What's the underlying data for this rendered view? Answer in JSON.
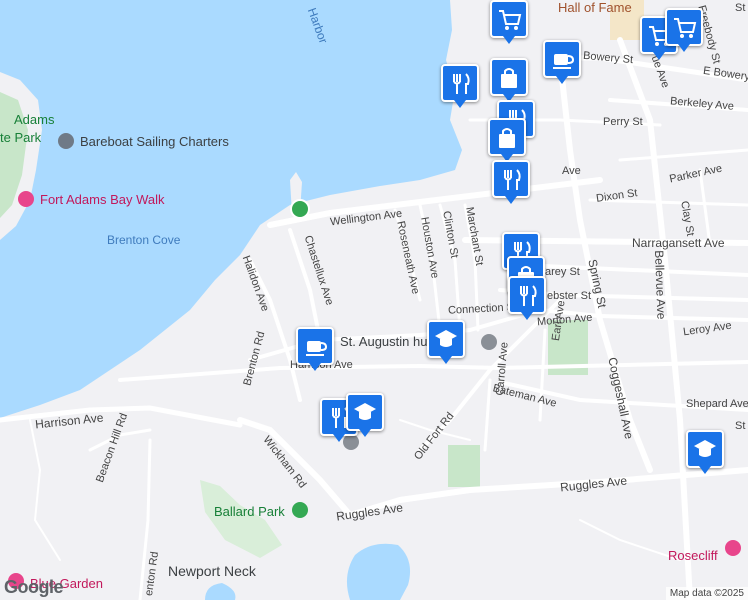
{
  "map": {
    "attribution": "Map data ©2025",
    "logo": "Google"
  },
  "water_labels": {
    "harbor": "Harbor",
    "cove": "Brenton Cove"
  },
  "poi_labels": {
    "hall_of_fame": "Hall of Fame",
    "adams_line1": "Adams",
    "adams_line2": "te Park",
    "sailing": "Bareboat Sailing Charters",
    "bay_walk": "Fort Adams Bay Walk",
    "church": "St. Augustin   hurch",
    "ballard": "Ballard Park",
    "newport_neck": "Newport Neck",
    "rosecliff": "Rosecliff",
    "garden": "Blue Garden"
  },
  "streets": {
    "wellington": "Wellington Ave",
    "narragansett": "Narragansett Ave",
    "bowery": "Bowery St",
    "e_bowery": "E Bowery",
    "berkeley": "Berkeley Ave",
    "perry": "Perry St",
    "parker": "Parker Ave",
    "dixon": "Dixon St",
    "clay": "Clay St",
    "halidon": "Halidon Ave",
    "chastellux": "Chastellux Ave",
    "roseneath": "Roseneath Ave",
    "houston": "Houston Ave",
    "clinton": "Clinton St",
    "marchant": "Marchant St",
    "carey": "arey St",
    "webster": "ebster St",
    "connection": "Connection St",
    "morton": "Morton Ave",
    "leroy": "Leroy Ave",
    "spring": "Spring St",
    "coggeshall": "Coggeshall Ave",
    "bellevue": "Bellevue Ave",
    "bellevue_top": "ue Ave",
    "freebody": "Freebody St",
    "harrison_s": "Harrison Ave",
    "harrison_n": "Harrison Ave",
    "bateman": "Bateman Ave",
    "earl": "Earl Ave",
    "carroll": "Carroll Ave",
    "old_fort": "Old Fort Rd",
    "shepard": "Shepard Ave",
    "ruggles_w": "Ruggles Ave",
    "ruggles_e": "Ruggles Ave",
    "brenton": "Brenton Rd",
    "wickham": "Wickham Rd",
    "beacon_hill": "Beacon Hill Rd",
    "brenton_s": "enton Rd",
    "avenue": "Ave",
    "st_a": "St",
    "st_b": "St"
  },
  "markers": [
    {
      "icon": "shopping-cart-icon"
    },
    {
      "icon": "shopping-cart-icon"
    },
    {
      "icon": "shopping-cart-icon"
    },
    {
      "icon": "coffee-icon"
    },
    {
      "icon": "restaurant-icon"
    },
    {
      "icon": "shopping-bag-icon"
    },
    {
      "icon": "restaurant-icon"
    },
    {
      "icon": "shopping-bag-icon"
    },
    {
      "icon": "restaurant-icon"
    },
    {
      "icon": "restaurant-icon"
    },
    {
      "icon": "shopping-bag-icon"
    },
    {
      "icon": "restaurant-icon"
    },
    {
      "icon": "school-icon"
    },
    {
      "icon": "coffee-icon"
    },
    {
      "icon": "restaurant-icon"
    },
    {
      "icon": "school-icon"
    },
    {
      "icon": "school-icon"
    }
  ],
  "colors": {
    "marker": "#1a73e8",
    "water": "#aadaff",
    "park": "#c8e6c9",
    "land": "#f1f1f4",
    "poi_pink": "#e8458b",
    "poi_green": "#34a853",
    "poi_gray": "#6f7a87"
  }
}
